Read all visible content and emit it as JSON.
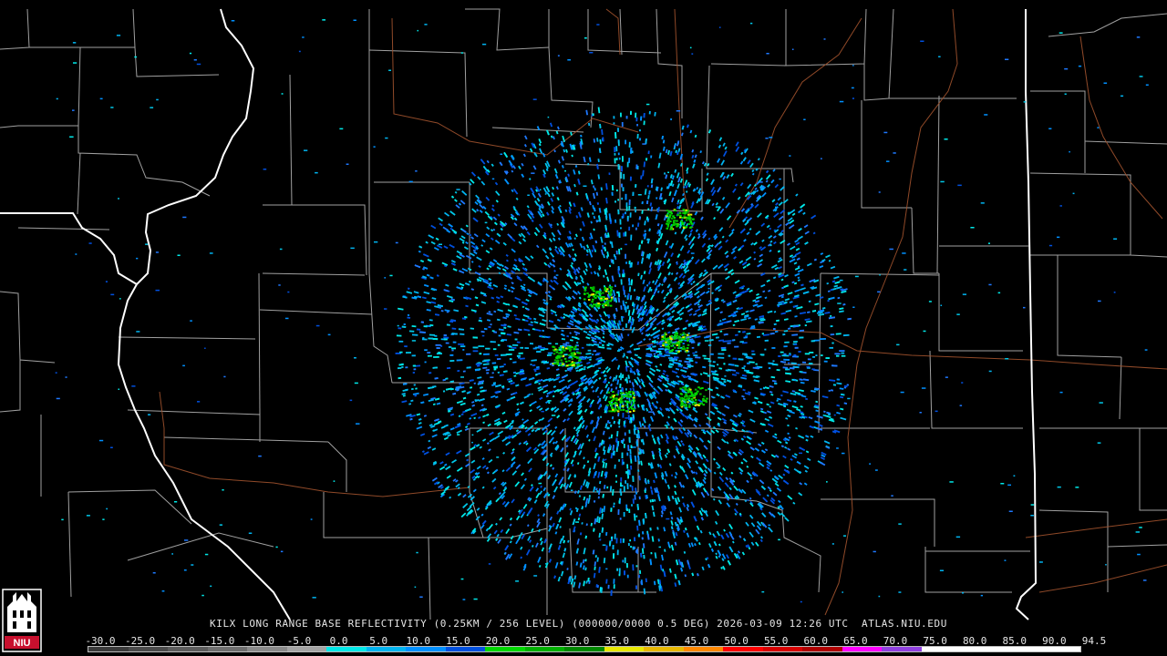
{
  "product": {
    "caption": "KILX LONG RANGE BASE REFLECTIVITY (0.25KM / 256 LEVEL) (000000/0000 0.5 DEG) 2026-03-09 12:26 UTC  ATLAS.NIU.EDU"
  },
  "logo": {
    "text": "NIU",
    "color": "#c8102e"
  },
  "colorscale": {
    "labels": [
      "-30.0",
      "-25.0",
      "-20.0",
      "-15.0",
      "-10.0",
      "-5.0",
      "0.0",
      "5.0",
      "10.0",
      "15.0",
      "20.0",
      "25.0",
      "30.0",
      "35.0",
      "40.0",
      "45.0",
      "50.0",
      "55.0",
      "60.0",
      "65.0",
      "70.0",
      "75.0",
      "80.0",
      "85.0",
      "90.0",
      "94.5"
    ],
    "colors": [
      "#3a3a3a",
      "#4a4a4a",
      "#5c5c5c",
      "#6e6e6e",
      "#8a8a8a",
      "#a4a4a4",
      "#00e8e8",
      "#00b4f0",
      "#0090ff",
      "#0050e0",
      "#00d800",
      "#00b000",
      "#008800",
      "#e8e800",
      "#e8b800",
      "#ff8800",
      "#ff0000",
      "#d80000",
      "#b00000",
      "#ff00ff",
      "#9040e0",
      "#ffffff",
      "#ffffff",
      "#ffffff",
      "#ffffff"
    ]
  },
  "map_colors": {
    "state_border": "#ffffff",
    "county_border": "#bdbdbd",
    "highway": "#a0522d",
    "background": "#000000"
  }
}
